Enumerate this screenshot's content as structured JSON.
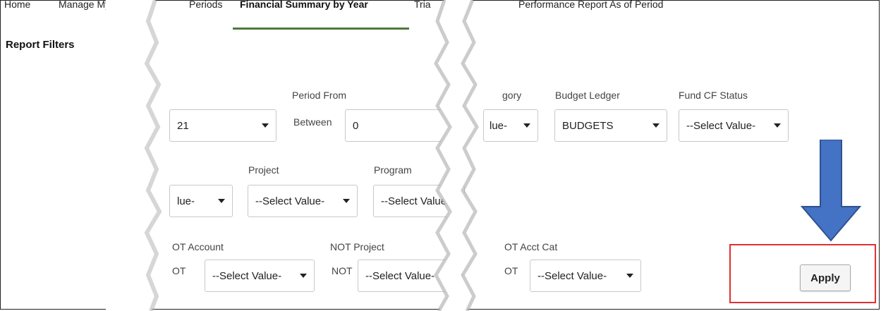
{
  "tabs": [
    {
      "label": "Home"
    },
    {
      "label": "Manage My B"
    },
    {
      "label": "Periods"
    },
    {
      "label": "Financial Summary by Year"
    },
    {
      "label": "Tria"
    },
    {
      "label": "Performance Report As of Period"
    }
  ],
  "report_filters": "Report Filters",
  "row1": {
    "fiscal_year_value": "21",
    "period_from_label": "Period From",
    "between_label": "Between",
    "period_from_value": "0",
    "account_category_label_fragment": "gory",
    "account_category_value": "lue-",
    "budget_ledger_label": "Budget Ledger",
    "budget_ledger_value": "BUDGETS",
    "fund_cf_status_label": "Fund CF Status",
    "fund_cf_status_value": "--Select Value-"
  },
  "row2": {
    "first_value": "lue-",
    "project_label": "Project",
    "project_value": "--Select Value-",
    "program_label": "Program",
    "program_value": "--Select Value"
  },
  "row3": {
    "not_account_label": "OT Account",
    "not_prefix_1": "OT",
    "not_account_value": "--Select Value-",
    "not_project_label": "NOT Project",
    "not_prefix_2": "NOT",
    "not_project_value": "--Select Value-",
    "not_acct_cat_label": "OT Acct Cat",
    "not_prefix_3": "OT",
    "not_acct_cat_value": "--Select Value-"
  },
  "apply_label": "Apply",
  "colors": {
    "accent_underline": "#4d7a3a",
    "highlight_box": "#e03030",
    "arrow": "#4472c4"
  },
  "icons": [
    "dropdown-caret-icon",
    "down-arrow-icon"
  ]
}
